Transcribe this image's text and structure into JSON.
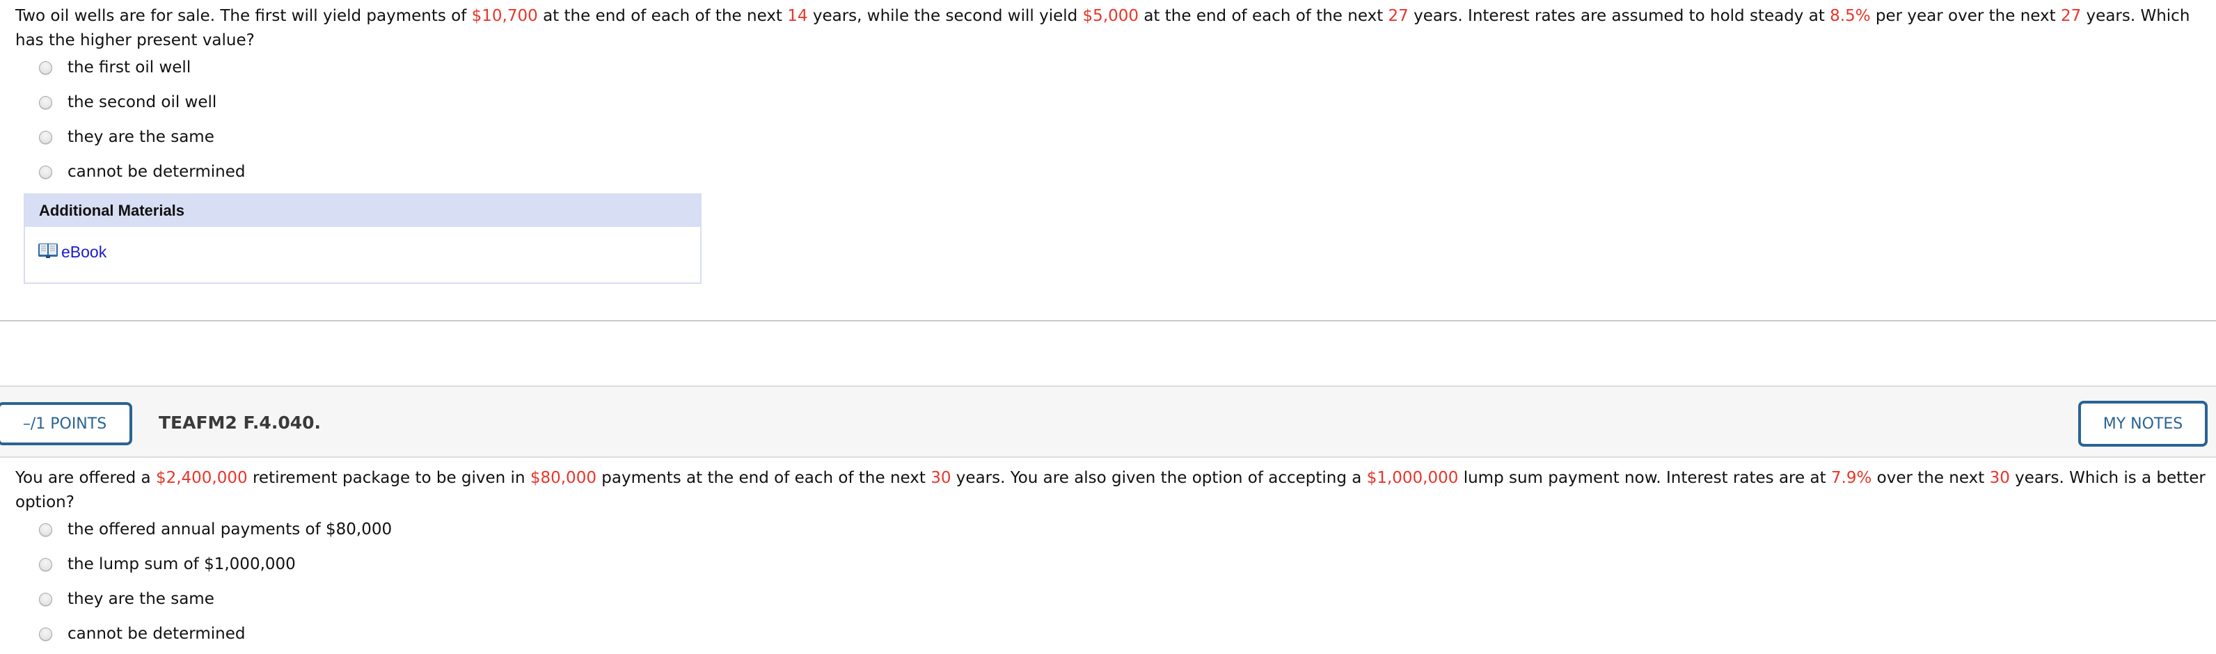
{
  "question1": {
    "text_segments": [
      {
        "t": "Two oil wells are for sale. The first will yield payments of ",
        "hl": false
      },
      {
        "t": "$10,700",
        "hl": true
      },
      {
        "t": " at the end of each of the next ",
        "hl": false
      },
      {
        "t": "14",
        "hl": true
      },
      {
        "t": " years, while the second will yield ",
        "hl": false
      },
      {
        "t": "$5,000",
        "hl": true
      },
      {
        "t": " at the end of each of the next ",
        "hl": false
      },
      {
        "t": "27",
        "hl": true
      },
      {
        "t": " years. Interest rates are assumed to hold steady at ",
        "hl": false
      },
      {
        "t": "8.5%",
        "hl": true
      },
      {
        "t": " per year over the next ",
        "hl": false
      },
      {
        "t": "27",
        "hl": true
      },
      {
        "t": " years. Which has the higher present value?",
        "hl": false
      }
    ],
    "choices": [
      {
        "label": "the first oil well",
        "selected": false
      },
      {
        "label": "the second oil well",
        "selected": false
      },
      {
        "label": "they are the same",
        "selected": false
      },
      {
        "label": "cannot be determined",
        "selected": false
      }
    ],
    "additional_materials": {
      "title": "Additional Materials",
      "links": [
        {
          "icon": "book-icon",
          "label": "eBook"
        }
      ]
    }
  },
  "question2": {
    "points_label": "–/1 POINTS",
    "question_id": "TEAFM2 F.4.040.",
    "my_notes_label": "MY NOTES",
    "text_segments": [
      {
        "t": "You are offered a ",
        "hl": false
      },
      {
        "t": "$2,400,000",
        "hl": true
      },
      {
        "t": " retirement package to be given in ",
        "hl": false
      },
      {
        "t": "$80,000",
        "hl": true
      },
      {
        "t": " payments at the end of each of the next ",
        "hl": false
      },
      {
        "t": "30",
        "hl": true
      },
      {
        "t": " years. You are also given the option of accepting a ",
        "hl": false
      },
      {
        "t": "$1,000,000",
        "hl": true
      },
      {
        "t": " lump sum payment now. Interest rates are at ",
        "hl": false
      },
      {
        "t": "7.9%",
        "hl": true
      },
      {
        "t": " over the next ",
        "hl": false
      },
      {
        "t": "30",
        "hl": true
      },
      {
        "t": " years. Which is a better option?",
        "hl": false
      }
    ],
    "choices": [
      {
        "label": "the offered annual payments of $80,000",
        "selected": false
      },
      {
        "label": "the lump sum of $1,000,000",
        "selected": false
      },
      {
        "label": "they are the same",
        "selected": false
      },
      {
        "label": "cannot be determined",
        "selected": false
      }
    ]
  },
  "colors": {
    "highlight": "#e8362a",
    "accent": "#2a6394",
    "link": "#1a1acf",
    "materials_header_bg": "#d8def3"
  }
}
